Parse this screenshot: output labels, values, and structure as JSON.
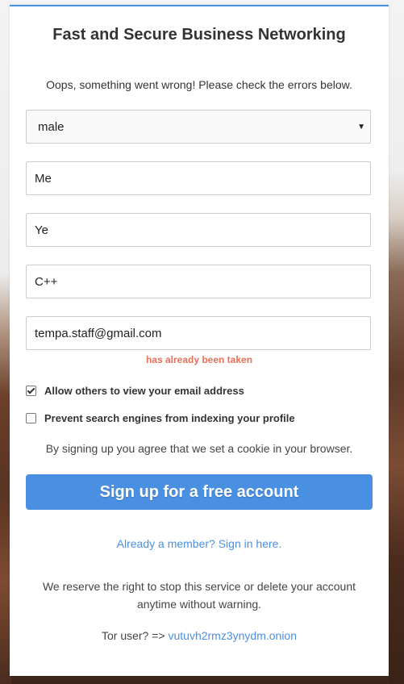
{
  "page": {
    "title": "Fast and Secure Business Networking",
    "error_summary": "Oops, something went wrong! Please check the errors below."
  },
  "form": {
    "gender_select": {
      "value": "male"
    },
    "first_name": {
      "value": "Me"
    },
    "last_name": {
      "value": "Ye"
    },
    "skill": {
      "value": "C++"
    },
    "email": {
      "value": "tempa.staff@gmail.com",
      "error": "has already been taken"
    },
    "checkboxes": [
      {
        "label": "Allow others to view your email address",
        "checked": true
      },
      {
        "label": "Prevent search engines from indexing your profile",
        "checked": false
      }
    ],
    "cookie_note": "By signing up you agree that we set a cookie in your browser.",
    "submit_label": "Sign up for a free account"
  },
  "footer": {
    "signin_link": "Already a member? Sign in here.",
    "disclaimer": "We reserve the right to stop this service or delete your account anytime without warning.",
    "tor_prefix": "Tor user? =>",
    "tor_link": "vutuvh2rmz3ynydm.onion"
  },
  "colors": {
    "accent": "#4a90e2",
    "error": "#e8705a"
  }
}
